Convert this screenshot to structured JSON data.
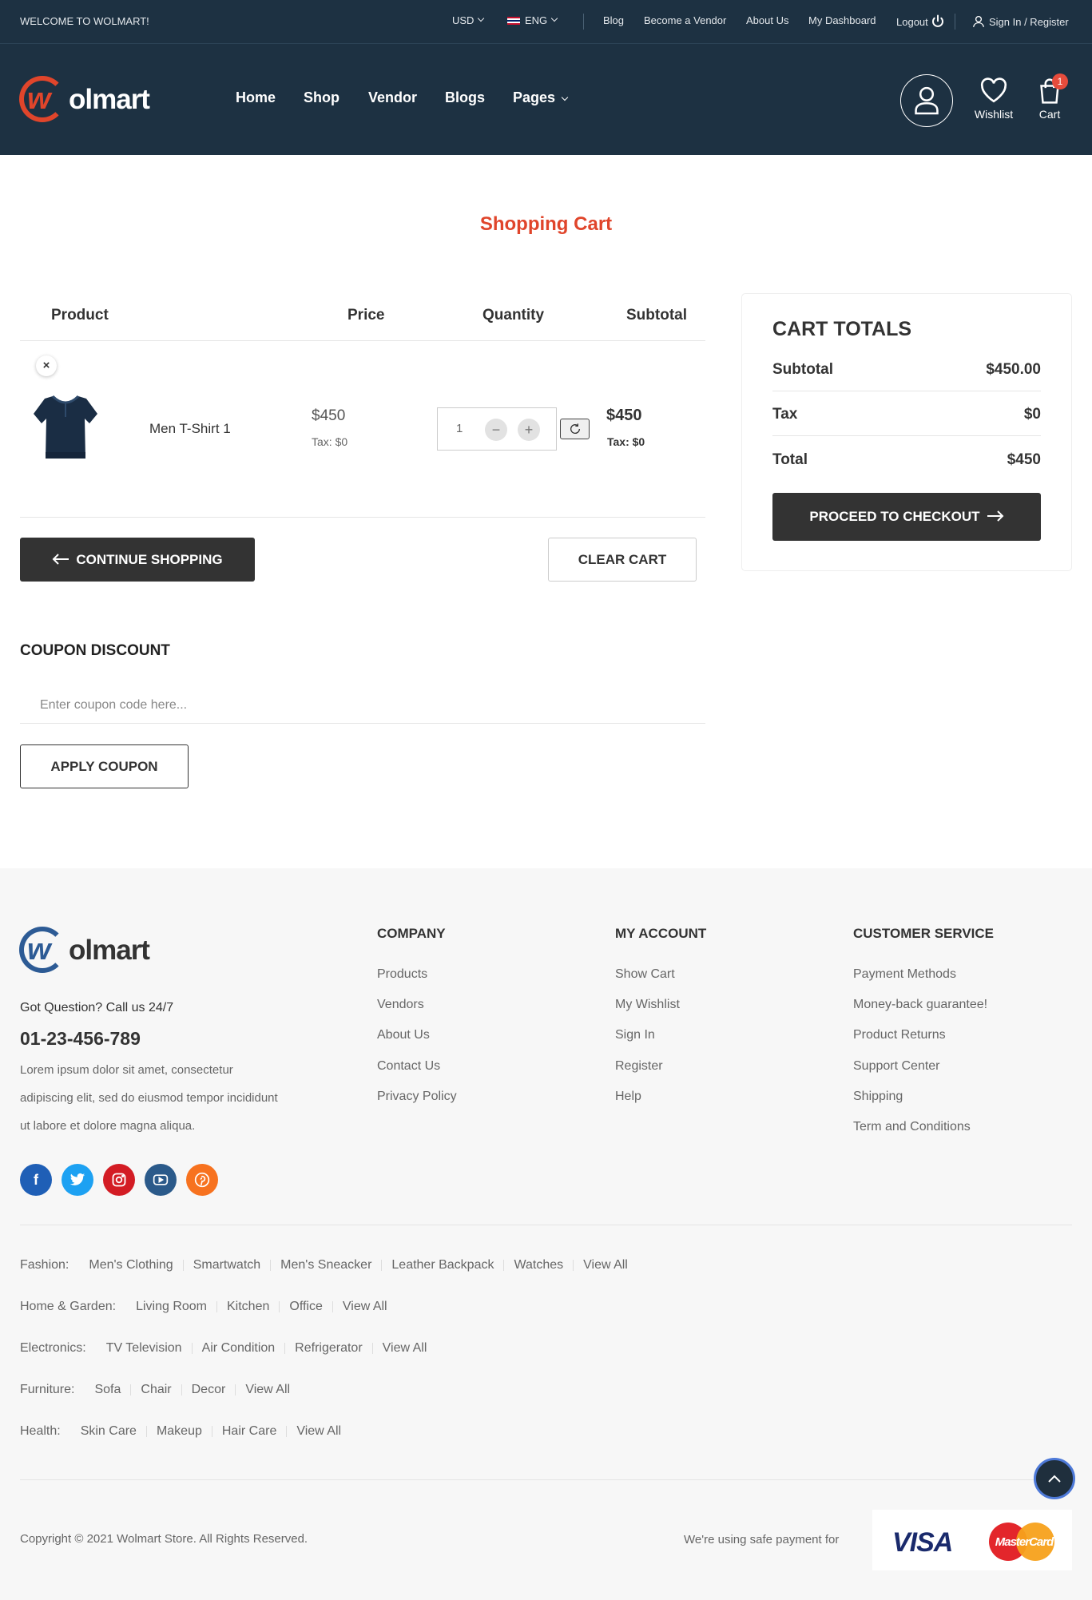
{
  "topbar": {
    "welcome": "WELCOME TO WOLMART!",
    "currency": "USD",
    "language": "ENG",
    "links": [
      "Blog",
      "Become a Vendor",
      "About Us",
      "My Dashboard",
      "Logout"
    ],
    "sign_in": "Sign In / Register"
  },
  "header": {
    "logo_text": "olmart",
    "logo_letter": "w",
    "nav": [
      "Home",
      "Shop",
      "Vendor",
      "Blogs",
      "Pages"
    ],
    "wishlist_label": "Wishlist",
    "cart_label": "Cart",
    "cart_count": "1"
  },
  "page_title": "Shopping Cart",
  "cart_table": {
    "headers": [
      "Product",
      "Price",
      "Quantity",
      "Subtotal"
    ],
    "items": [
      {
        "name": "Men T-Shirt 1",
        "price": "$450",
        "price_tax": "Tax: $0",
        "quantity": "1",
        "subtotal": "$450",
        "subtotal_tax": "Tax: $0"
      }
    ],
    "continue_label": "CONTINUE SHOPPING",
    "clear_label": "CLEAR CART"
  },
  "coupon": {
    "title": "COUPON DISCOUNT",
    "placeholder": "Enter coupon code here...",
    "apply_label": "APPLY COUPON"
  },
  "totals": {
    "title": "CART TOTALS",
    "subtotal_label": "Subtotal",
    "subtotal_value": "$450.00",
    "tax_label": "Tax",
    "tax_value": "$0",
    "total_label": "Total",
    "total_value": "$450",
    "checkout_label": "PROCEED TO CHECKOUT"
  },
  "footer": {
    "question": "Got Question? Call us 24/7",
    "phone": "01-23-456-789",
    "about_lines": [
      "Lorem ipsum dolor sit amet, consectetur",
      "adipiscing elit, sed do eiusmod tempor incididunt",
      "ut labore et dolore magna aliqua."
    ],
    "company": {
      "title": "COMPANY",
      "links": [
        "Products",
        "Vendors",
        "About Us",
        "Contact Us",
        "Privacy Policy"
      ]
    },
    "account": {
      "title": "MY ACCOUNT",
      "links": [
        "Show Cart",
        "My Wishlist",
        "Sign In",
        "Register",
        "Help"
      ]
    },
    "service": {
      "title": "CUSTOMER SERVICE",
      "links": [
        "Payment Methods",
        "Money-back guarantee!",
        "Product Returns",
        "Support Center",
        "Shipping",
        "Term and Conditions"
      ]
    },
    "social_colors": [
      "#1f5fb6",
      "#1da1f2",
      "#d31c24",
      "#2b5a8a",
      "#f7721f"
    ],
    "categories": [
      {
        "label": "Fashion:",
        "items": [
          "Men's Clothing",
          "Smartwatch",
          "Men's Sneacker",
          "Leather Backpack",
          "Watches",
          "View All"
        ]
      },
      {
        "label": "Home & Garden:",
        "items": [
          "Living Room",
          "Kitchen",
          "Office",
          "View All"
        ]
      },
      {
        "label": "Electronics:",
        "items": [
          "TV Television",
          "Air Condition",
          "Refrigerator",
          "View All"
        ]
      },
      {
        "label": "Furniture:",
        "items": [
          "Sofa",
          "Chair",
          "Decor",
          "View All"
        ]
      },
      {
        "label": "Health:",
        "items": [
          "Skin Care",
          "Makeup",
          "Hair Care",
          "View All"
        ]
      }
    ],
    "copyright": "Copyright © 2021 Wolmart Store. All Rights Reserved.",
    "payment_text": "We're using safe payment for",
    "visa": "VISA",
    "mastercard": "MasterCard"
  },
  "colors": {
    "header_bg": "#1d3142",
    "accent": "#e0452b",
    "dark_button": "#333333",
    "footer_bg": "#f7f7f7"
  }
}
